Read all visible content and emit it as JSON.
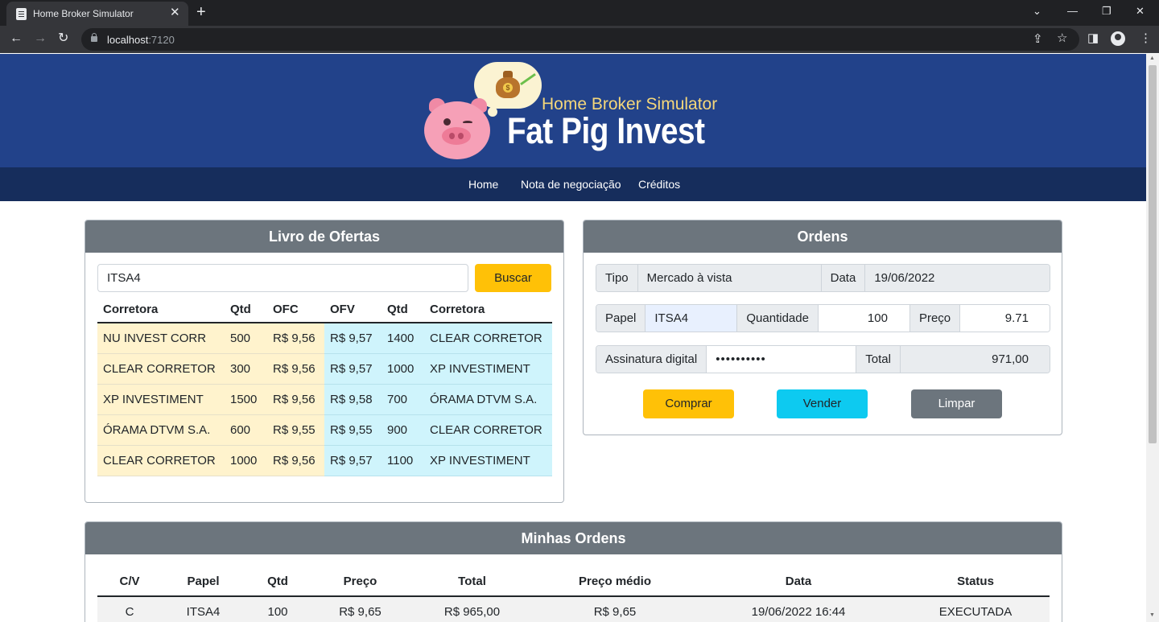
{
  "browser": {
    "tab_title": "Home Broker Simulator",
    "url_host": "localhost",
    "url_port": ":7120"
  },
  "header": {
    "logo_subtitle": "Home Broker Simulator",
    "logo_title": "Fat Pig Invest"
  },
  "nav": {
    "items": [
      "Home",
      "Nota de negociação",
      "Créditos"
    ]
  },
  "livro": {
    "title": "Livro de Ofertas",
    "search_value": "ITSA4",
    "search_button": "Buscar",
    "columns": [
      "Corretora",
      "Qtd",
      "OFC",
      "OFV",
      "Qtd",
      "Corretora"
    ],
    "rows": [
      [
        "NU INVEST CORR",
        "500",
        "R$ 9,56",
        "R$ 9,57",
        "1400",
        "CLEAR CORRETOR"
      ],
      [
        "CLEAR CORRETOR",
        "300",
        "R$ 9,56",
        "R$ 9,57",
        "1000",
        "XP INVESTIMENT"
      ],
      [
        "XP INVESTIMENT",
        "1500",
        "R$ 9,56",
        "R$ 9,58",
        "700",
        "ÓRAMA DTVM S.A."
      ],
      [
        "ÓRAMA DTVM S.A.",
        "600",
        "R$ 9,55",
        "R$ 9,55",
        "900",
        "CLEAR CORRETOR"
      ],
      [
        "CLEAR CORRETOR",
        "1000",
        "R$ 9,56",
        "R$ 9,57",
        "1100",
        "XP INVESTIMENT"
      ]
    ]
  },
  "ordens": {
    "title": "Ordens",
    "tipo_label": "Tipo",
    "tipo_value": "Mercado à vista",
    "data_label": "Data",
    "data_value": "19/06/2022",
    "papel_label": "Papel",
    "papel_value": "ITSA4",
    "quantidade_label": "Quantidade",
    "quantidade_value": "100",
    "preco_label": "Preço",
    "preco_value": "9.71",
    "assinatura_label": "Assinatura digital",
    "assinatura_value": "••••••••••",
    "total_label": "Total",
    "total_value": "971,00",
    "comprar": "Comprar",
    "vender": "Vender",
    "limpar": "Limpar"
  },
  "minhas_ordens": {
    "title": "Minhas Ordens",
    "columns": [
      "C/V",
      "Papel",
      "Qtd",
      "Preço",
      "Total",
      "Preço médio",
      "Data",
      "Status"
    ],
    "rows": [
      [
        "C",
        "ITSA4",
        "100",
        "R$ 9,65",
        "R$ 965,00",
        "R$ 9,65",
        "19/06/2022 16:44",
        "EXECUTADA"
      ]
    ]
  },
  "colors": {
    "header_bg": "#22428a",
    "nav_bg": "#162d5c",
    "card_header": "#6c757d",
    "buy": "#ffc107",
    "sell": "#0dcaf0",
    "clear": "#6c757d"
  }
}
